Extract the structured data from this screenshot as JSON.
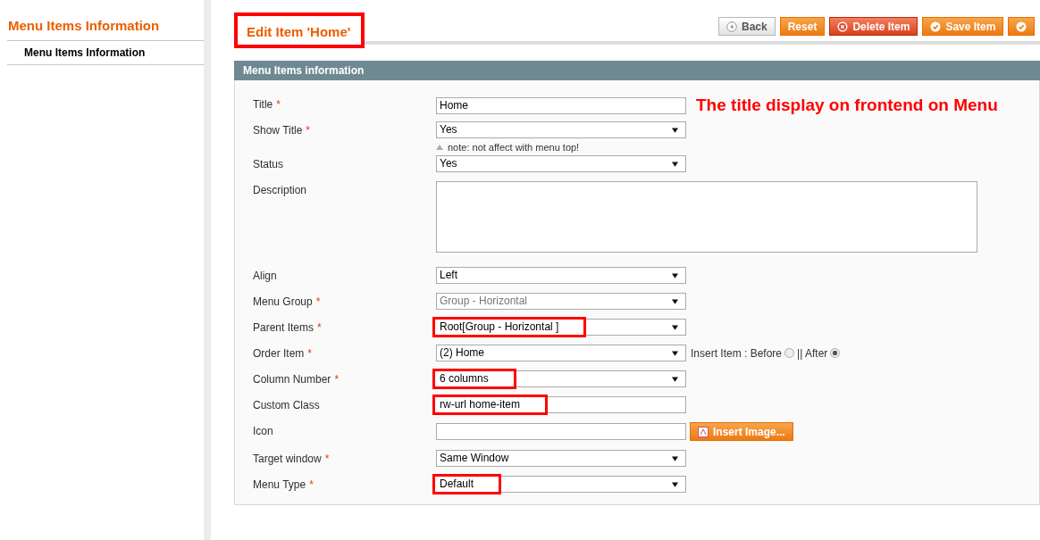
{
  "sidebar": {
    "title": "Menu Items Information",
    "items": [
      {
        "label": "Menu Items Information",
        "selected": true
      }
    ]
  },
  "header": {
    "title": "Edit Item 'Home'",
    "title_highlighted": true,
    "buttons": [
      {
        "label": "Back",
        "kind": "back"
      },
      {
        "label": "Reset",
        "kind": "plain"
      },
      {
        "label": "Delete Item",
        "kind": "delete"
      },
      {
        "label": "Save Item",
        "kind": "save"
      },
      {
        "kind": "save-cut"
      }
    ]
  },
  "form": {
    "section_title": "Menu Items information",
    "rows": [
      {
        "label": "Title",
        "required_mark": "*",
        "kind": "text",
        "value": "Home",
        "highlighted": false,
        "annotation": "The title display on frontend on Menu"
      },
      {
        "label": "Show Title",
        "required_mark": "*",
        "kind": "select",
        "value": "Yes",
        "highlighted": false,
        "note": "note: not affect with menu top!"
      },
      {
        "label": "Status",
        "kind": "select",
        "value": "Yes",
        "highlighted": false
      },
      {
        "label": "Description",
        "kind": "textarea"
      },
      {
        "label": "Align",
        "kind": "select",
        "value": "Left",
        "highlighted": false
      },
      {
        "label": "Menu Group",
        "required_mark": "*",
        "kind": "select",
        "value": "Group - Horizontal",
        "highlighted": false,
        "disabled": true
      },
      {
        "label": "Parent Items",
        "required_mark": "*",
        "kind": "select",
        "value": "Root[Group - Horizontal ]",
        "highlighted": true
      },
      {
        "label": "Order Item",
        "required_mark": "*",
        "kind": "select",
        "value": "(2) Home",
        "highlighted": false,
        "insert": {
          "label": "Insert Item : Before",
          "separator": "|| After",
          "options": [
            {
              "selected": false
            },
            {
              "selected": true
            }
          ]
        }
      },
      {
        "label": "Column Number",
        "required_mark": "*",
        "kind": "select",
        "value": "6 columns",
        "highlighted": true
      },
      {
        "label": "Custom Class",
        "kind": "text",
        "value": "rw-url home-item",
        "highlighted": true
      },
      {
        "label": "Icon",
        "kind": "image",
        "highlighted": false,
        "button": "Insert Image..."
      },
      {
        "label": "Target window",
        "required_mark": "*",
        "kind": "select",
        "value": "Same Window",
        "highlighted": false
      },
      {
        "label": "Menu Type",
        "required_mark": "*",
        "kind": "select",
        "value": "Default",
        "highlighted": true
      }
    ]
  }
}
